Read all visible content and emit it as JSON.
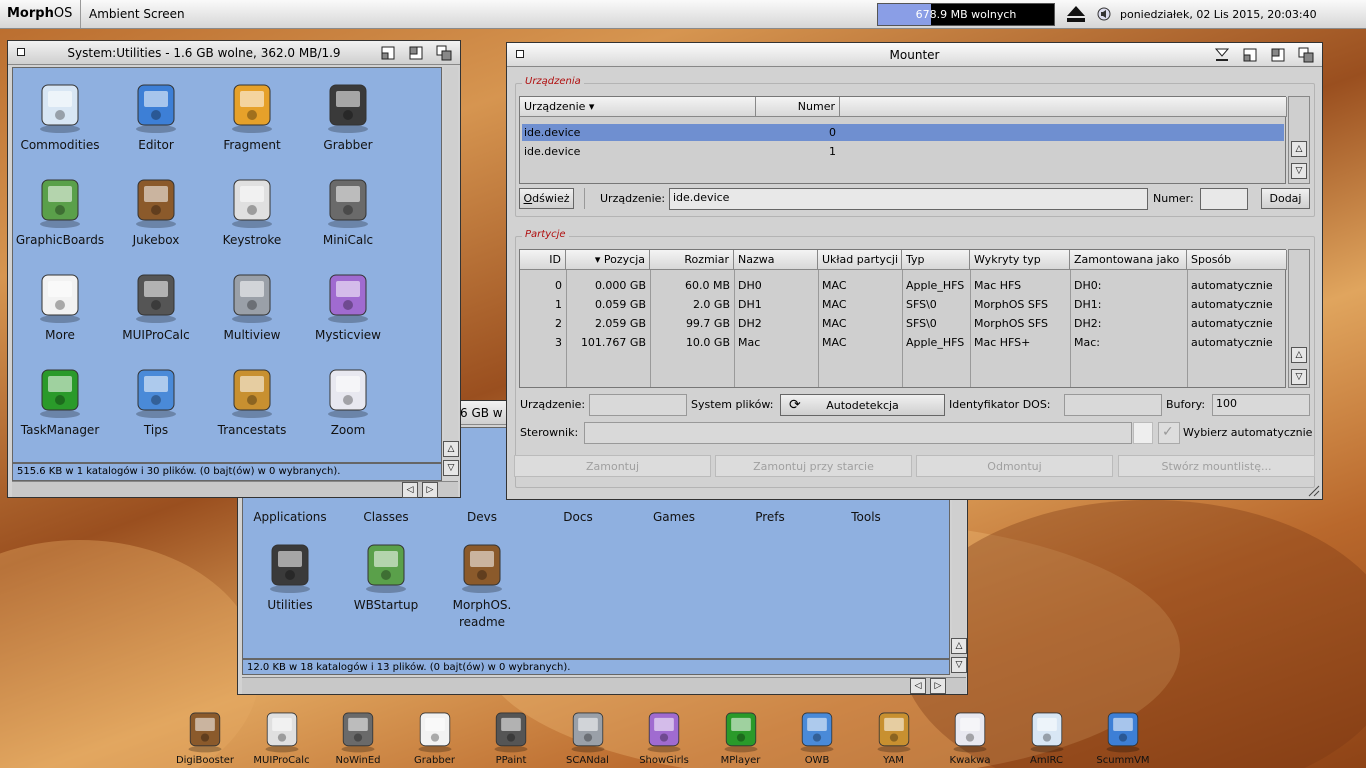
{
  "topbar": {
    "logo_morph": "Morph",
    "logo_os": "OS",
    "screen_title": "Ambient Screen",
    "memory_text": "678.9 MB wolnych",
    "memory_fill_percent": 30,
    "clock": "poniedziałek, 02 Lis 2015, 20:03:40"
  },
  "utilities_window": {
    "title": "System:Utilities - 1.6 GB wolne, 362.0 MB/1.9",
    "status": "515.6 KB w 1 katalogów i 30 plików. (0 bajt(ów) w 0 wybranych).",
    "icons": [
      "Commodities",
      "Editor",
      "Fragment",
      "Grabber",
      "GraphicBoards",
      "Jukebox",
      "Keystroke",
      "MiniCalc",
      "More",
      "MUIProCalc",
      "Multiview",
      "Mysticview",
      "TaskManager",
      "Tips",
      "Trancestats",
      "Zoom"
    ]
  },
  "system_window": {
    "title_fragment": "6 GB w",
    "status": "12.0 KB w 18 katalogów i 13 plików. (0 bajt(ów) w 0 wybranych).",
    "icons_top": [
      "Applications",
      "Classes",
      "Devs",
      "Docs",
      "Games",
      "Prefs",
      "Tools"
    ],
    "icons": [
      "Utilities",
      "WBStartup",
      "MorphOS.\nreadme"
    ]
  },
  "mounter": {
    "title": "Mounter",
    "devices_group": "Urządzenia",
    "devices_columns": [
      "Urządzenie",
      "Numer"
    ],
    "devices": [
      {
        "device": "ide.device",
        "number": "0"
      },
      {
        "device": "ide.device",
        "number": "1"
      }
    ],
    "refresh_btn": "Odśwież",
    "device_label": "Urządzenie:",
    "device_value": "ide.device",
    "number_label": "Numer:",
    "number_value": "",
    "add_btn": "Dodaj",
    "partitions_group": "Partycje",
    "partition_columns": [
      "ID",
      "Pozycja",
      "Rozmiar",
      "Nazwa",
      "Układ partycji",
      "Typ",
      "Wykryty typ",
      "Zamontowana jako",
      "Sposób"
    ],
    "partitions": [
      {
        "id": "0",
        "pos": "0.000 GB",
        "size": "60.0 MB",
        "name": "DH0",
        "layout": "MAC",
        "type": "Apple_HFS",
        "detected": "Mac HFS",
        "mounted": "DH0:",
        "mode": "automatycznie"
      },
      {
        "id": "1",
        "pos": "0.059 GB",
        "size": "2.0 GB",
        "name": "DH1",
        "layout": "MAC",
        "type": "SFS\\0",
        "detected": "MorphOS SFS",
        "mounted": "DH1:",
        "mode": "automatycznie"
      },
      {
        "id": "2",
        "pos": "2.059 GB",
        "size": "99.7 GB",
        "name": "DH2",
        "layout": "MAC",
        "type": "SFS\\0",
        "detected": "MorphOS SFS",
        "mounted": "DH2:",
        "mode": "automatycznie"
      },
      {
        "id": "3",
        "pos": "101.767 GB",
        "size": "10.0 GB",
        "name": "Mac",
        "layout": "MAC",
        "type": "Apple_HFS",
        "detected": "Mac HFS+",
        "mounted": "Mac:",
        "mode": "automatycznie"
      }
    ],
    "p_device_label": "Urządzenie:",
    "fs_label": "System plików:",
    "fs_value": "Autodetekcja",
    "dosid_label": "Identyfikator DOS:",
    "buffers_label": "Bufory:",
    "buffers_value": "100",
    "driver_label": "Sterownik:",
    "auto_label": "Wybierz automatycznie",
    "buttons": [
      "Zamontuj",
      "Zamontuj przy starcie",
      "Odmontuj",
      "Stwórz mountlistę..."
    ]
  },
  "dock": [
    "DigiBooster",
    "MUIProCalc",
    "NoWinEd",
    "Grabber",
    "PPaint",
    "SCANdal",
    "ShowGirls",
    "MPlayer",
    "OWB",
    "YAM",
    "Kwakwa",
    "AmIRC",
    "ScummVM"
  ],
  "colors": {
    "icon_area": "#8fb0e0",
    "selection": "#6f8fd0",
    "group_label": "#b01010",
    "memory_fill": "#8a9ee6"
  }
}
